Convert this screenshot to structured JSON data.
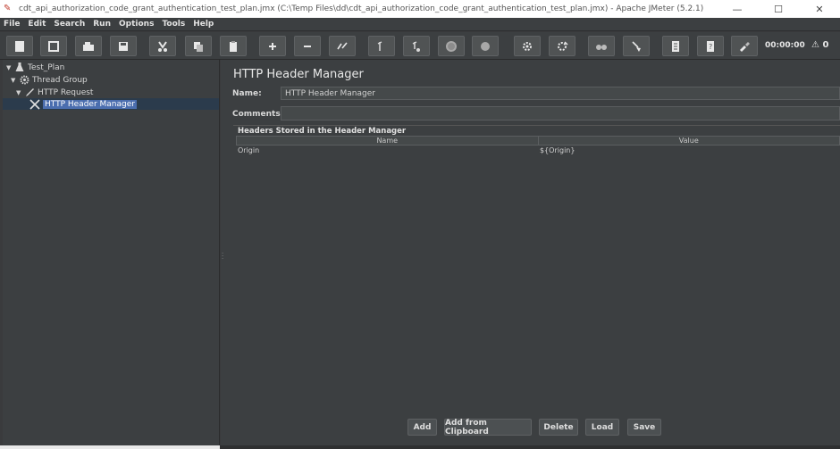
{
  "window": {
    "title": "cdt_api_authorization_code_grant_authentication_test_plan.jmx (C:\\Temp Files\\dd\\cdt_api_authorization_code_grant_authentication_test_plan.jmx) - Apache JMeter (5.2.1)",
    "minimize": "—",
    "maximize": "☐",
    "close": "✕"
  },
  "menu": [
    "File",
    "Edit",
    "Search",
    "Run",
    "Options",
    "Tools",
    "Help"
  ],
  "toolbar": {
    "icons": [
      "new-icon",
      "templates-icon",
      "open-icon",
      "save-icon",
      "cut-icon",
      "copy-icon",
      "paste-icon",
      "expand-icon",
      "collapse-icon",
      "toggle-icon",
      "start-icon",
      "start-no-pause-icon",
      "stop-icon",
      "shutdown-icon",
      "remote-start-icon",
      "remote-stop-icon",
      "binoculars-icon",
      "broom-icon",
      "function-helper-icon",
      "help-icon",
      "tool-icon"
    ],
    "timer": "00:00:00",
    "warnings": "⚠ 0"
  },
  "tree": {
    "items": [
      {
        "label": "Test_Plan",
        "icon": "flask-icon"
      },
      {
        "label": "Thread Group",
        "icon": "gear-icon"
      },
      {
        "label": "HTTP Request",
        "icon": "pen-icon"
      },
      {
        "label": "HTTP Header Manager",
        "icon": "wrench-icon"
      }
    ]
  },
  "main": {
    "title": "HTTP Header Manager",
    "name_label": "Name:",
    "name_value": "HTTP Header Manager",
    "comments_label": "Comments:",
    "comments_value": "",
    "group_title": "Headers Stored in the Header Manager",
    "columns": [
      "Name",
      "Value"
    ],
    "rows": [
      {
        "name": "Origin",
        "value": "${Origin}"
      }
    ],
    "buttons": [
      "Add",
      "Add from Clipboard",
      "Delete",
      "Load",
      "Save"
    ]
  }
}
